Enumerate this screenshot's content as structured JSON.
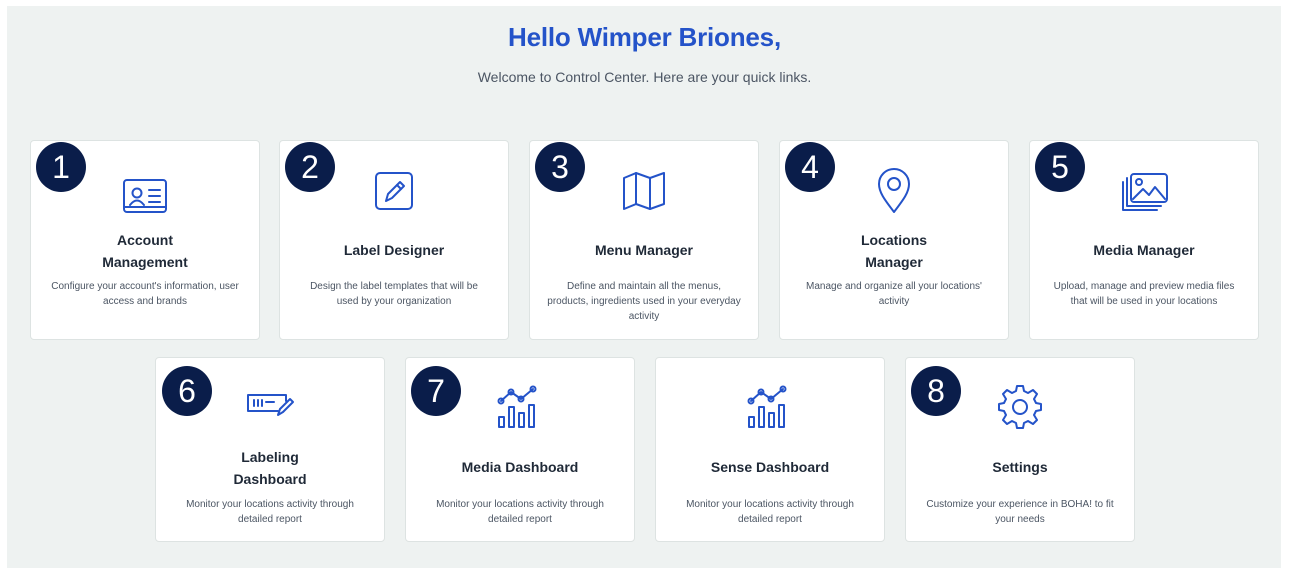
{
  "header": {
    "greeting": "Hello Wimper Briones,",
    "subtitle": "Welcome to Control Center. Here are your quick links."
  },
  "cards": [
    {
      "badge": "1",
      "icon": "id-card-icon",
      "title_l1": "Account",
      "title_l2": "Management",
      "desc_l1": "Configure your account's information, user",
      "desc_l2": "access and brands",
      "desc_l3": ""
    },
    {
      "badge": "2",
      "icon": "pencil-square-icon",
      "title_l1": "Label Designer",
      "title_l2": "",
      "desc_l1": "Design the label templates that will be",
      "desc_l2": "used by your organization",
      "desc_l3": ""
    },
    {
      "badge": "3",
      "icon": "map-icon",
      "title_l1": "Menu Manager",
      "title_l2": "",
      "desc_l1": "Define and maintain all the menus,",
      "desc_l2": "products, ingredients used in your everyday",
      "desc_l3": "activity"
    },
    {
      "badge": "4",
      "icon": "location-pin-icon",
      "title_l1": "Locations",
      "title_l2": "Manager",
      "desc_l1": "Manage and organize all your locations'",
      "desc_l2": "activity",
      "desc_l3": ""
    },
    {
      "badge": "5",
      "icon": "images-icon",
      "title_l1": "Media Manager",
      "title_l2": "",
      "desc_l1": "Upload, manage and preview media files",
      "desc_l2": "that will be used in your locations",
      "desc_l3": ""
    },
    {
      "badge": "6",
      "icon": "label-dashboard-icon",
      "title_l1": "Labeling",
      "title_l2": "Dashboard",
      "desc_l1": "Monitor your locations activity through",
      "desc_l2": "detailed report",
      "desc_l3": ""
    },
    {
      "badge": "7",
      "icon": "bar-chart-trend-icon",
      "title_l1": "Media Dashboard",
      "title_l2": "",
      "desc_l1": "Monitor your locations activity through",
      "desc_l2": "detailed report",
      "desc_l3": ""
    },
    {
      "badge": "",
      "icon": "bar-chart-trend-icon",
      "title_l1": "Sense Dashboard",
      "title_l2": "",
      "desc_l1": "Monitor your locations activity through",
      "desc_l2": "detailed report",
      "desc_l3": ""
    },
    {
      "badge": "8",
      "icon": "gear-icon",
      "title_l1": "Settings",
      "title_l2": "",
      "desc_l1": "Customize your experience in BOHA! to fit",
      "desc_l2": "your needs",
      "desc_l3": ""
    }
  ],
  "colors": {
    "accent": "#2453c9",
    "badge": "#0a1d4a",
    "background": "#eef2f1"
  }
}
